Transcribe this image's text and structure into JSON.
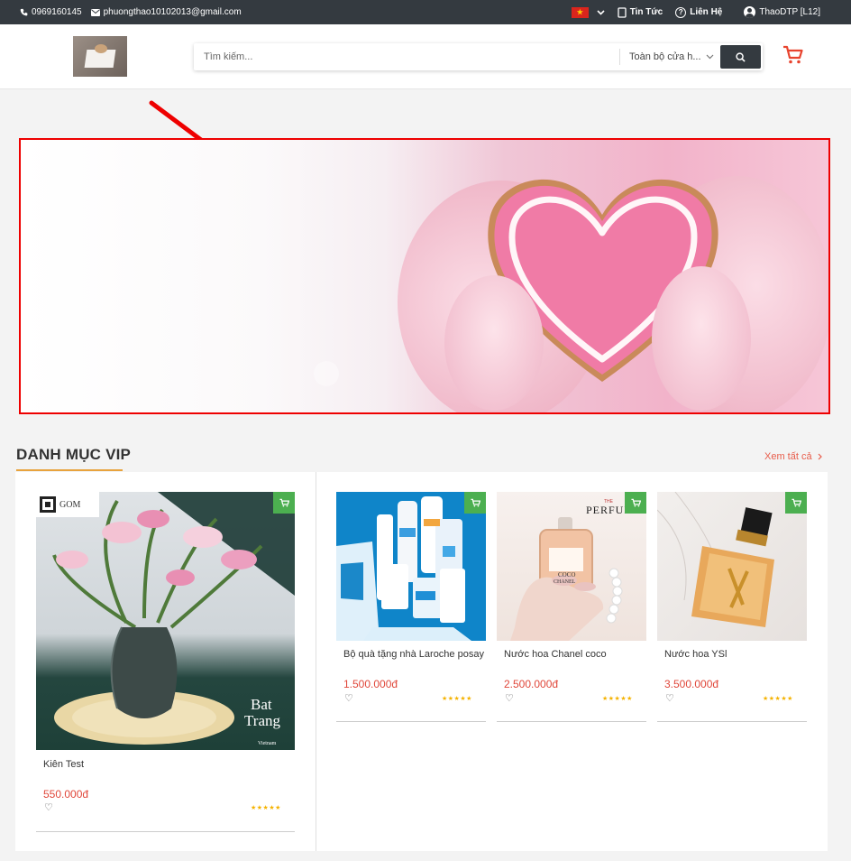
{
  "topbar": {
    "phone": "0969160145",
    "email": "phuongthao10102013@gmail.com",
    "news": "Tin Tức",
    "contact": "Liên Hệ",
    "user": "ThaoDTP [L12]"
  },
  "search": {
    "placeholder": "Tìm kiếm...",
    "scope": "Toàn bộ cửa h..."
  },
  "section": {
    "title": "DANH MỤC VIP",
    "see_all": "Xem tất cả"
  },
  "products": [
    {
      "name": "Kiên Test",
      "price": "550.000đ",
      "rating": "★★★★★"
    },
    {
      "name": "Bộ quà tặng nhà Laroche posay",
      "price": "1.500.000đ",
      "rating": "★★★★★"
    },
    {
      "name": "Nước hoa Chanel coco",
      "price": "2.500.000đ",
      "rating": "★★★★★"
    },
    {
      "name": "Nước hoa YSl",
      "price": "3.500.000đ",
      "rating": "★★★★★"
    }
  ],
  "image_text": {
    "gom": "GOM",
    "bat": "Bat",
    "trang": "Trang",
    "vietnam": "Vietnam",
    "perfume_the": "THE",
    "perfume": "PERFUME",
    "coco": "COCO",
    "chanel": "CHANEL"
  },
  "colors": {
    "topbar_bg": "#343a40",
    "accent_red": "#e0473a",
    "cart_badge": "#4caf50",
    "section_underline": "#e8a33d",
    "banner_border": "#ee0000"
  }
}
